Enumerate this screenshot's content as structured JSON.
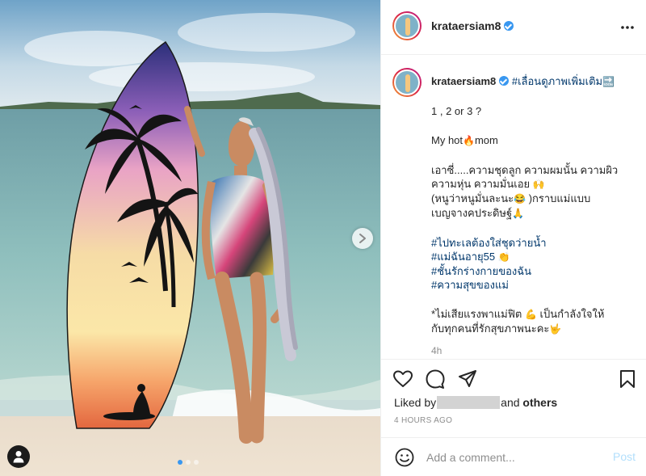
{
  "post": {
    "username": "krataersiam8",
    "caption_user": "krataersiam8",
    "caption_lines": [
      {
        "parts": [
          {
            "t": "1 , 2 or 3 ?"
          }
        ]
      },
      {
        "gap": true
      },
      {
        "parts": [
          {
            "t": "My hot"
          },
          {
            "t": "🔥",
            "emoji": true
          },
          {
            "t": "mom"
          }
        ]
      },
      {
        "gap": true
      },
      {
        "parts": [
          {
            "t": "เอาซี่.....ความชุดลูก ความผมนั้น ความผิว"
          }
        ]
      },
      {
        "parts": [
          {
            "t": "ความหุ่น ความมั่นเอย "
          },
          {
            "t": "🙌",
            "emoji": true
          }
        ]
      },
      {
        "parts": [
          {
            "t": "(หนูว่าหนูมั่นละนะ"
          },
          {
            "t": "😂",
            "emoji": true
          },
          {
            "t": " )กราบแม่แบบ"
          }
        ]
      },
      {
        "parts": [
          {
            "t": "เบญจางคประดิษฐ์"
          },
          {
            "t": "🙏",
            "emoji": true
          }
        ]
      },
      {
        "gap": true
      },
      {
        "parts": [
          {
            "t": "#ไปทะเลต้องใส่ชุดว่ายน้ำ",
            "tag": true
          }
        ]
      },
      {
        "parts": [
          {
            "t": "#แม่ฉันอายุ55 ",
            "tag": true
          },
          {
            "t": "👏",
            "emoji": true
          }
        ]
      },
      {
        "parts": [
          {
            "t": "#ชั้นรักร่างกายของฉัน",
            "tag": true
          }
        ]
      },
      {
        "parts": [
          {
            "t": "#ความสุขของแม่",
            "tag": true
          }
        ]
      },
      {
        "gap": true
      },
      {
        "parts": [
          {
            "t": "*ไม่เสียแรงพาแม่ฟิต "
          },
          {
            "t": "💪",
            "emoji": true
          },
          {
            "t": " เป็นกำลังใจให้"
          }
        ]
      },
      {
        "parts": [
          {
            "t": "กับทุกคนที่รักสุขภาพนะคะ"
          },
          {
            "t": "🤟",
            "emoji": true
          }
        ]
      }
    ],
    "caption_first_tag": "#เลื่อนดูภาพเพิ่มเติม",
    "caption_first_emoji": "🔜",
    "time_ago": "4h",
    "liked_prefix": "Liked by",
    "liked_suffix_and": "and",
    "liked_others": "others",
    "posted_time": "4 HOURS AGO"
  },
  "comment": {
    "placeholder": "Add a comment...",
    "post_label": "Post"
  },
  "carousel": {
    "count": 3,
    "active_index": 0
  },
  "colors": {
    "accent": "#3897f0",
    "link": "#00376b",
    "post_disabled": "#b2dffc"
  }
}
